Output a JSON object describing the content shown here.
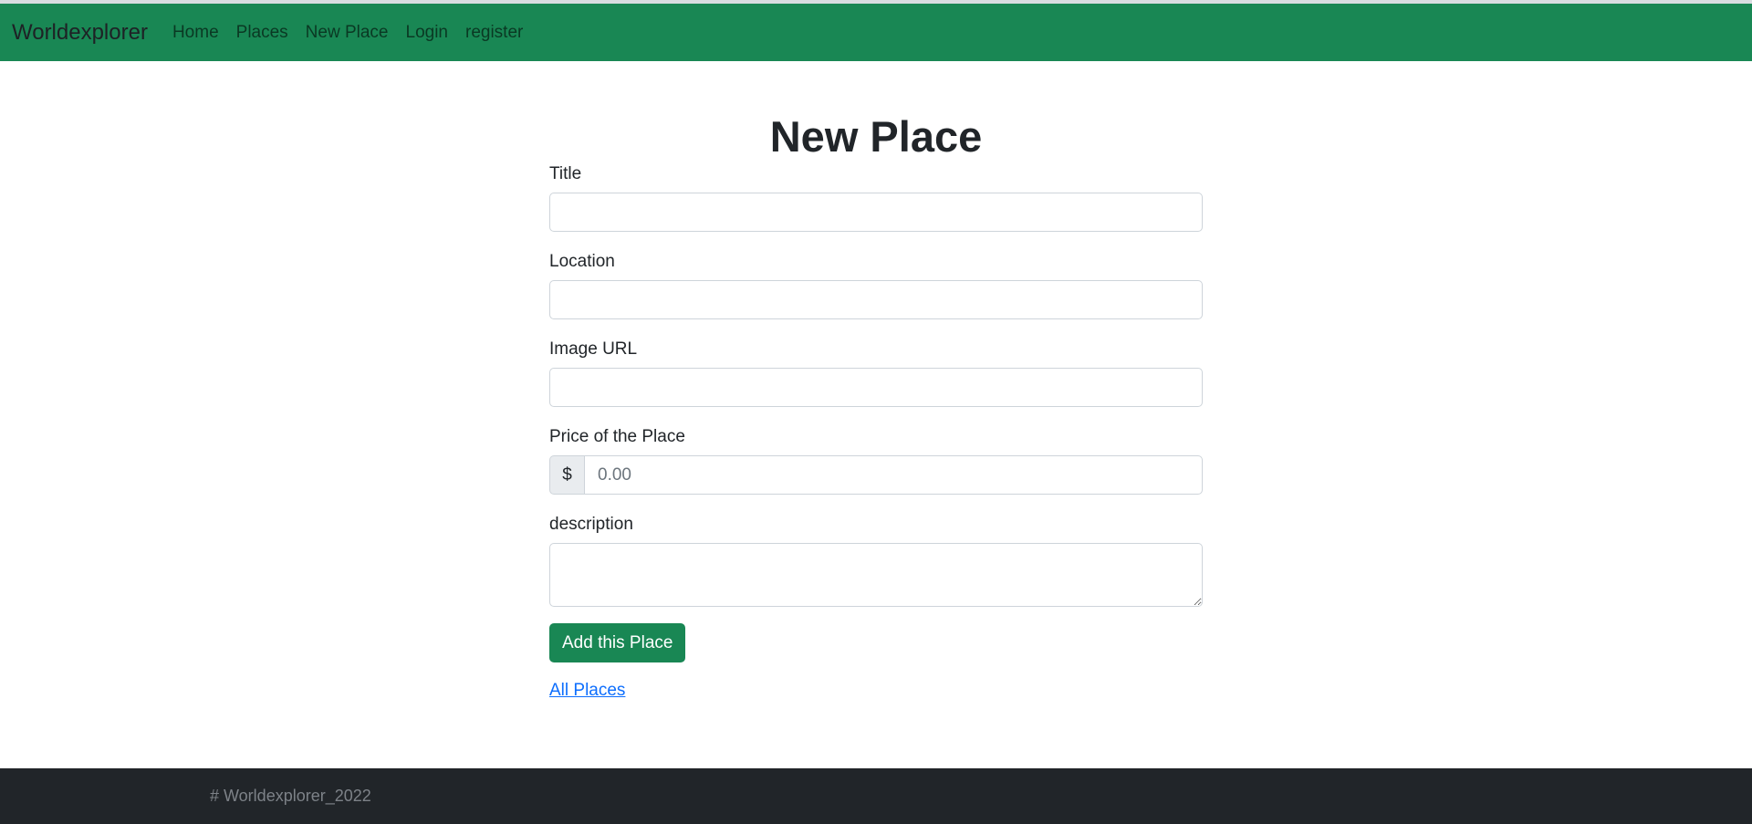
{
  "navbar": {
    "brand": "Worldexplorer",
    "links": [
      "Home",
      "Places",
      "New Place",
      "Login",
      "register"
    ]
  },
  "form": {
    "heading": "New Place",
    "title_label": "Title",
    "title_value": "",
    "location_label": "Location",
    "location_value": "",
    "image_label": "Image URL",
    "image_value": "",
    "price_label": "Price of the Place",
    "price_currency": "$",
    "price_placeholder": "0.00",
    "description_label": "description",
    "description_value": "",
    "submit_label": "Add this Place",
    "all_places_link": "All Places"
  },
  "footer": {
    "text": "# Worldexplorer_2022"
  },
  "colors": {
    "primary_green": "#198754",
    "link_blue": "#0d6efd",
    "footer_bg": "#212529"
  }
}
